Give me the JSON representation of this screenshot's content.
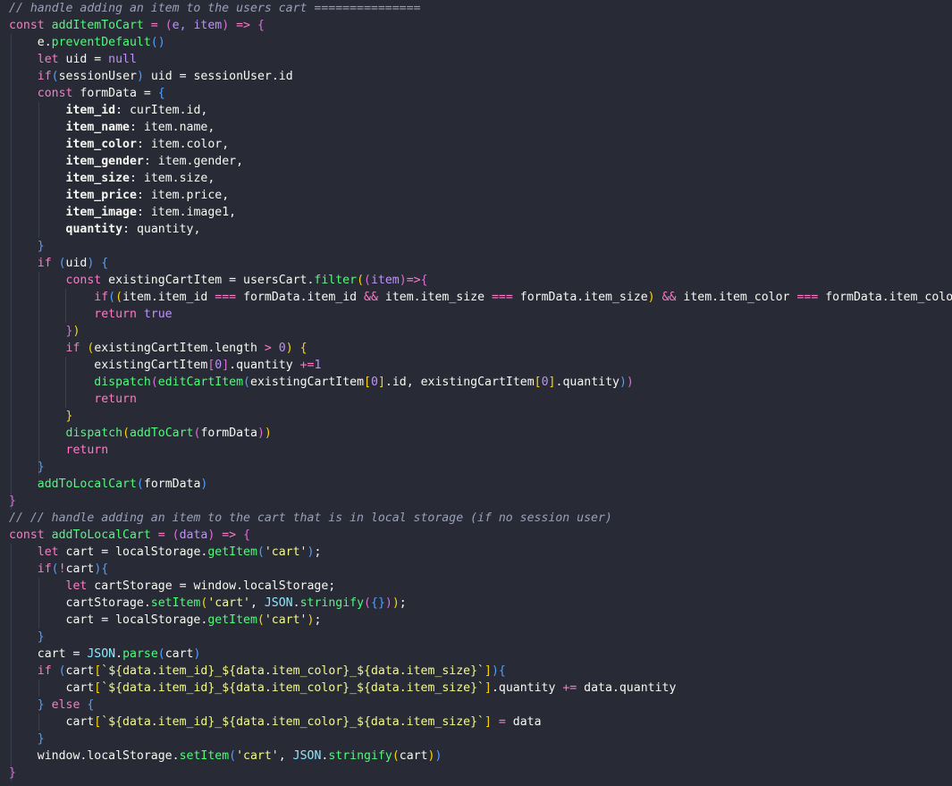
{
  "editor": {
    "lines": [
      [
        {
          "t": "// handle adding an item to the users cart ===============",
          "c": "comment"
        }
      ],
      [
        {
          "t": "const ",
          "c": "keyword"
        },
        {
          "t": "addItemToCart",
          "c": "func"
        },
        {
          "t": " = ",
          "c": "op"
        },
        {
          "t": "(",
          "c": "paren2"
        },
        {
          "t": "e, item",
          "c": "var"
        },
        {
          "t": ")",
          "c": "paren2"
        },
        {
          "t": " => ",
          "c": "keyword"
        },
        {
          "t": "{",
          "c": "paren2"
        }
      ],
      [
        {
          "t": "    e.",
          "c": "plain"
        },
        {
          "t": "preventDefault",
          "c": "func"
        },
        {
          "t": "()",
          "c": "paren3"
        }
      ],
      [
        {
          "t": "    ",
          "c": "plain"
        },
        {
          "t": "let ",
          "c": "keyword"
        },
        {
          "t": "uid = ",
          "c": "plain"
        },
        {
          "t": "null",
          "c": "bool"
        }
      ],
      [
        {
          "t": "    ",
          "c": "plain"
        },
        {
          "t": "if",
          "c": "keyword"
        },
        {
          "t": "(",
          "c": "paren3"
        },
        {
          "t": "sessionUser",
          "c": "plain"
        },
        {
          "t": ")",
          "c": "paren3"
        },
        {
          "t": " uid = sessionUser.id",
          "c": "plain"
        }
      ],
      [
        {
          "t": "    ",
          "c": "plain"
        },
        {
          "t": "const ",
          "c": "keyword"
        },
        {
          "t": "formData = ",
          "c": "plain"
        },
        {
          "t": "{",
          "c": "paren3"
        }
      ],
      [
        {
          "t": "        ",
          "c": "plain"
        },
        {
          "t": "item_id",
          "c": "prop"
        },
        {
          "t": ": curItem.id,",
          "c": "plain"
        }
      ],
      [
        {
          "t": "        ",
          "c": "plain"
        },
        {
          "t": "item_name",
          "c": "prop"
        },
        {
          "t": ": item.name,",
          "c": "plain"
        }
      ],
      [
        {
          "t": "        ",
          "c": "plain"
        },
        {
          "t": "item_color",
          "c": "prop"
        },
        {
          "t": ": item.color,",
          "c": "plain"
        }
      ],
      [
        {
          "t": "        ",
          "c": "plain"
        },
        {
          "t": "item_gender",
          "c": "prop"
        },
        {
          "t": ": item.gender,",
          "c": "plain"
        }
      ],
      [
        {
          "t": "        ",
          "c": "plain"
        },
        {
          "t": "item_size",
          "c": "prop"
        },
        {
          "t": ": item.size,",
          "c": "plain"
        }
      ],
      [
        {
          "t": "        ",
          "c": "plain"
        },
        {
          "t": "item_price",
          "c": "prop"
        },
        {
          "t": ": item.price,",
          "c": "plain"
        }
      ],
      [
        {
          "t": "        ",
          "c": "plain"
        },
        {
          "t": "item_image",
          "c": "prop"
        },
        {
          "t": ": item.image1,",
          "c": "plain"
        }
      ],
      [
        {
          "t": "        ",
          "c": "plain"
        },
        {
          "t": "quantity",
          "c": "prop"
        },
        {
          "t": ": quantity,",
          "c": "plain"
        }
      ],
      [
        {
          "t": "    ",
          "c": "plain"
        },
        {
          "t": "}",
          "c": "paren3"
        }
      ],
      [
        {
          "t": "    ",
          "c": "plain"
        },
        {
          "t": "if ",
          "c": "keyword"
        },
        {
          "t": "(",
          "c": "paren3"
        },
        {
          "t": "uid",
          "c": "plain"
        },
        {
          "t": ")",
          "c": "paren3"
        },
        {
          "t": " ",
          "c": "plain"
        },
        {
          "t": "{",
          "c": "paren3"
        }
      ],
      [
        {
          "t": "        ",
          "c": "plain"
        },
        {
          "t": "const ",
          "c": "keyword"
        },
        {
          "t": "existingCartItem = usersCart.",
          "c": "plain"
        },
        {
          "t": "filter",
          "c": "func"
        },
        {
          "t": "(",
          "c": "paren1"
        },
        {
          "t": "(",
          "c": "paren2"
        },
        {
          "t": "item",
          "c": "var"
        },
        {
          "t": ")",
          "c": "paren2"
        },
        {
          "t": "=>",
          "c": "keyword"
        },
        {
          "t": "{",
          "c": "paren2"
        }
      ],
      [
        {
          "t": "            ",
          "c": "plain"
        },
        {
          "t": "if",
          "c": "keyword"
        },
        {
          "t": "(",
          "c": "paren3"
        },
        {
          "t": "(",
          "c": "paren1"
        },
        {
          "t": "item.item_id ",
          "c": "plain"
        },
        {
          "t": "===",
          "c": "op"
        },
        {
          "t": " formData.item_id ",
          "c": "plain"
        },
        {
          "t": "&&",
          "c": "op"
        },
        {
          "t": " item.item_size ",
          "c": "plain"
        },
        {
          "t": "===",
          "c": "op"
        },
        {
          "t": " formData.item_size",
          "c": "plain"
        },
        {
          "t": ")",
          "c": "paren1"
        },
        {
          "t": " ",
          "c": "plain"
        },
        {
          "t": "&&",
          "c": "op"
        },
        {
          "t": " item.item_color ",
          "c": "plain"
        },
        {
          "t": "===",
          "c": "op"
        },
        {
          "t": " formData.item_color",
          "c": "plain"
        },
        {
          "t": ")",
          "c": "paren3"
        }
      ],
      [
        {
          "t": "            ",
          "c": "plain"
        },
        {
          "t": "return ",
          "c": "keyword"
        },
        {
          "t": "true",
          "c": "bool"
        }
      ],
      [
        {
          "t": "        ",
          "c": "plain"
        },
        {
          "t": "}",
          "c": "paren2"
        },
        {
          "t": ")",
          "c": "paren1"
        }
      ],
      [
        {
          "t": "        ",
          "c": "plain"
        },
        {
          "t": "if ",
          "c": "keyword"
        },
        {
          "t": "(",
          "c": "paren1"
        },
        {
          "t": "existingCartItem.length ",
          "c": "plain"
        },
        {
          "t": ">",
          "c": "op"
        },
        {
          "t": " ",
          "c": "plain"
        },
        {
          "t": "0",
          "c": "number"
        },
        {
          "t": ")",
          "c": "paren1"
        },
        {
          "t": " ",
          "c": "plain"
        },
        {
          "t": "{",
          "c": "paren1"
        }
      ],
      [
        {
          "t": "            existingCartItem",
          "c": "plain"
        },
        {
          "t": "[",
          "c": "paren2"
        },
        {
          "t": "0",
          "c": "number"
        },
        {
          "t": "]",
          "c": "paren2"
        },
        {
          "t": ".quantity ",
          "c": "plain"
        },
        {
          "t": "+=",
          "c": "op"
        },
        {
          "t": "1",
          "c": "number"
        }
      ],
      [
        {
          "t": "            ",
          "c": "plain"
        },
        {
          "t": "dispatch",
          "c": "func"
        },
        {
          "t": "(",
          "c": "paren2"
        },
        {
          "t": "editCartItem",
          "c": "func"
        },
        {
          "t": "(",
          "c": "paren3"
        },
        {
          "t": "existingCartItem",
          "c": "plain"
        },
        {
          "t": "[",
          "c": "paren1"
        },
        {
          "t": "0",
          "c": "number"
        },
        {
          "t": "]",
          "c": "paren1"
        },
        {
          "t": ".id, existingCartItem",
          "c": "plain"
        },
        {
          "t": "[",
          "c": "paren1"
        },
        {
          "t": "0",
          "c": "number"
        },
        {
          "t": "]",
          "c": "paren1"
        },
        {
          "t": ".quantity",
          "c": "plain"
        },
        {
          "t": ")",
          "c": "paren3"
        },
        {
          "t": ")",
          "c": "paren2"
        }
      ],
      [
        {
          "t": "            ",
          "c": "plain"
        },
        {
          "t": "return",
          "c": "keyword"
        }
      ],
      [
        {
          "t": "        ",
          "c": "plain"
        },
        {
          "t": "}",
          "c": "paren1"
        }
      ],
      [
        {
          "t": "        ",
          "c": "plain"
        },
        {
          "t": "dispatch",
          "c": "func"
        },
        {
          "t": "(",
          "c": "paren1"
        },
        {
          "t": "addToCart",
          "c": "func"
        },
        {
          "t": "(",
          "c": "paren2"
        },
        {
          "t": "formData",
          "c": "plain"
        },
        {
          "t": ")",
          "c": "paren2"
        },
        {
          "t": ")",
          "c": "paren1"
        }
      ],
      [
        {
          "t": "        ",
          "c": "plain"
        },
        {
          "t": "return",
          "c": "keyword"
        }
      ],
      [
        {
          "t": "    ",
          "c": "plain"
        },
        {
          "t": "}",
          "c": "paren3"
        }
      ],
      [
        {
          "t": "    ",
          "c": "plain"
        },
        {
          "t": "addToLocalCart",
          "c": "func"
        },
        {
          "t": "(",
          "c": "paren3"
        },
        {
          "t": "formData",
          "c": "plain"
        },
        {
          "t": ")",
          "c": "paren3"
        }
      ],
      [
        {
          "t": "}",
          "c": "paren2"
        }
      ],
      [
        {
          "t": "// // handle adding an item to the cart that is in local storage (if no session user)",
          "c": "comment"
        }
      ],
      [
        {
          "t": "const ",
          "c": "keyword"
        },
        {
          "t": "addToLocalCart",
          "c": "func"
        },
        {
          "t": " = ",
          "c": "op"
        },
        {
          "t": "(",
          "c": "paren2"
        },
        {
          "t": "data",
          "c": "var"
        },
        {
          "t": ")",
          "c": "paren2"
        },
        {
          "t": " => ",
          "c": "keyword"
        },
        {
          "t": "{",
          "c": "paren2"
        }
      ],
      [
        {
          "t": "    ",
          "c": "plain"
        },
        {
          "t": "let ",
          "c": "keyword"
        },
        {
          "t": "cart = localStorage.",
          "c": "plain"
        },
        {
          "t": "getItem",
          "c": "func"
        },
        {
          "t": "(",
          "c": "paren3"
        },
        {
          "t": "'cart'",
          "c": "string"
        },
        {
          "t": ")",
          "c": "paren3"
        },
        {
          "t": ";",
          "c": "plain"
        }
      ],
      [
        {
          "t": "    ",
          "c": "plain"
        },
        {
          "t": "if",
          "c": "keyword"
        },
        {
          "t": "(",
          "c": "paren3"
        },
        {
          "t": "!",
          "c": "op"
        },
        {
          "t": "cart",
          "c": "plain"
        },
        {
          "t": ")",
          "c": "paren3"
        },
        {
          "t": "{",
          "c": "paren3"
        }
      ],
      [
        {
          "t": "        ",
          "c": "plain"
        },
        {
          "t": "let ",
          "c": "keyword"
        },
        {
          "t": "cartStorage = window.localStorage;",
          "c": "plain"
        }
      ],
      [
        {
          "t": "        cartStorage.",
          "c": "plain"
        },
        {
          "t": "setItem",
          "c": "func"
        },
        {
          "t": "(",
          "c": "paren1"
        },
        {
          "t": "'cart'",
          "c": "string"
        },
        {
          "t": ", ",
          "c": "plain"
        },
        {
          "t": "JSON",
          "c": "builtin"
        },
        {
          "t": ".",
          "c": "plain"
        },
        {
          "t": "stringify",
          "c": "func"
        },
        {
          "t": "(",
          "c": "paren2"
        },
        {
          "t": "{}",
          "c": "paren3"
        },
        {
          "t": ")",
          "c": "paren2"
        },
        {
          "t": ")",
          "c": "paren1"
        },
        {
          "t": ";",
          "c": "plain"
        }
      ],
      [
        {
          "t": "        cart = localStorage.",
          "c": "plain"
        },
        {
          "t": "getItem",
          "c": "func"
        },
        {
          "t": "(",
          "c": "paren1"
        },
        {
          "t": "'cart'",
          "c": "string"
        },
        {
          "t": ")",
          "c": "paren1"
        },
        {
          "t": ";",
          "c": "plain"
        }
      ],
      [
        {
          "t": "    ",
          "c": "plain"
        },
        {
          "t": "}",
          "c": "paren3"
        }
      ],
      [
        {
          "t": "    cart = ",
          "c": "plain"
        },
        {
          "t": "JSON",
          "c": "builtin"
        },
        {
          "t": ".",
          "c": "plain"
        },
        {
          "t": "parse",
          "c": "func"
        },
        {
          "t": "(",
          "c": "paren3"
        },
        {
          "t": "cart",
          "c": "plain"
        },
        {
          "t": ")",
          "c": "paren3"
        }
      ],
      [
        {
          "t": "    ",
          "c": "plain"
        },
        {
          "t": "if ",
          "c": "keyword"
        },
        {
          "t": "(",
          "c": "paren3"
        },
        {
          "t": "cart",
          "c": "plain"
        },
        {
          "t": "[",
          "c": "paren1"
        },
        {
          "t": "`${data.item_id}_${data.item_color}_${data.item_size}`",
          "c": "string"
        },
        {
          "t": "]",
          "c": "paren1"
        },
        {
          "t": ")",
          "c": "paren3"
        },
        {
          "t": "{",
          "c": "paren3"
        }
      ],
      [
        {
          "t": "        cart",
          "c": "plain"
        },
        {
          "t": "[",
          "c": "paren1"
        },
        {
          "t": "`${data.item_id}_${data.item_color}_${data.item_size}`",
          "c": "string"
        },
        {
          "t": "]",
          "c": "paren1"
        },
        {
          "t": ".quantity ",
          "c": "plain"
        },
        {
          "t": "+=",
          "c": "op"
        },
        {
          "t": " data.quantity",
          "c": "plain"
        }
      ],
      [
        {
          "t": "    ",
          "c": "plain"
        },
        {
          "t": "}",
          "c": "paren3"
        },
        {
          "t": " ",
          "c": "plain"
        },
        {
          "t": "else ",
          "c": "keyword"
        },
        {
          "t": "{",
          "c": "paren3"
        }
      ],
      [
        {
          "t": "        cart",
          "c": "plain"
        },
        {
          "t": "[",
          "c": "paren1"
        },
        {
          "t": "`${data.item_id}_${data.item_color}_${data.item_size}`",
          "c": "string"
        },
        {
          "t": "]",
          "c": "paren1"
        },
        {
          "t": " ",
          "c": "plain"
        },
        {
          "t": "=",
          "c": "op"
        },
        {
          "t": " data",
          "c": "plain"
        }
      ],
      [
        {
          "t": "    ",
          "c": "plain"
        },
        {
          "t": "}",
          "c": "paren3"
        }
      ],
      [
        {
          "t": "    window.localStorage.",
          "c": "plain"
        },
        {
          "t": "setItem",
          "c": "func"
        },
        {
          "t": "(",
          "c": "paren3"
        },
        {
          "t": "'cart'",
          "c": "string"
        },
        {
          "t": ", ",
          "c": "plain"
        },
        {
          "t": "JSON",
          "c": "builtin"
        },
        {
          "t": ".",
          "c": "plain"
        },
        {
          "t": "stringify",
          "c": "func"
        },
        {
          "t": "(",
          "c": "paren1"
        },
        {
          "t": "cart",
          "c": "plain"
        },
        {
          "t": ")",
          "c": "paren1"
        },
        {
          "t": ")",
          "c": "paren3"
        }
      ],
      [
        {
          "t": "}",
          "c": "paren2"
        }
      ]
    ]
  }
}
